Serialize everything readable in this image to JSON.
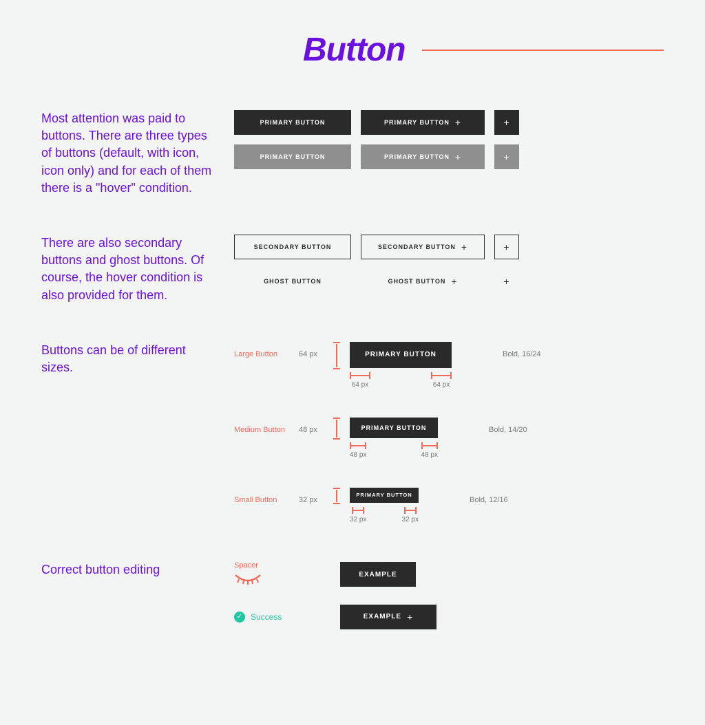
{
  "title": "Button",
  "desc1": "Most attention was paid to buttons. There are three types of buttons (default, with icon, icon only) and for each of them there is a \"hover\" condition.",
  "desc2": "There are also secondary buttons and ghost buttons. Of course, the hover condition is also provided for them.",
  "desc3": "Buttons can be of different sizes.",
  "desc4": "Correct button editing",
  "primary_label": "PRIMARY BUTTON",
  "secondary_label": "SECONDARY BUTTON",
  "ghost_label": "GHOST BUTTON",
  "example_label": "EXAMPLE",
  "sizes": {
    "large": {
      "name": "Large Button",
      "height_label": "64 px",
      "pad_left": "64 px",
      "pad_right": "64 px",
      "spec": "Bold, 16/24"
    },
    "medium": {
      "name": "Medium Button",
      "height_label": "48 px",
      "pad_left": "48 px",
      "pad_right": "48 px",
      "spec": "Bold, 14/20"
    },
    "small": {
      "name": "Small Button",
      "height_label": "32 px",
      "pad_left": "32 px",
      "pad_right": "32 px",
      "spec": "Bold, 12/16"
    }
  },
  "spacer_label": "Spacer",
  "success_label": "Success"
}
